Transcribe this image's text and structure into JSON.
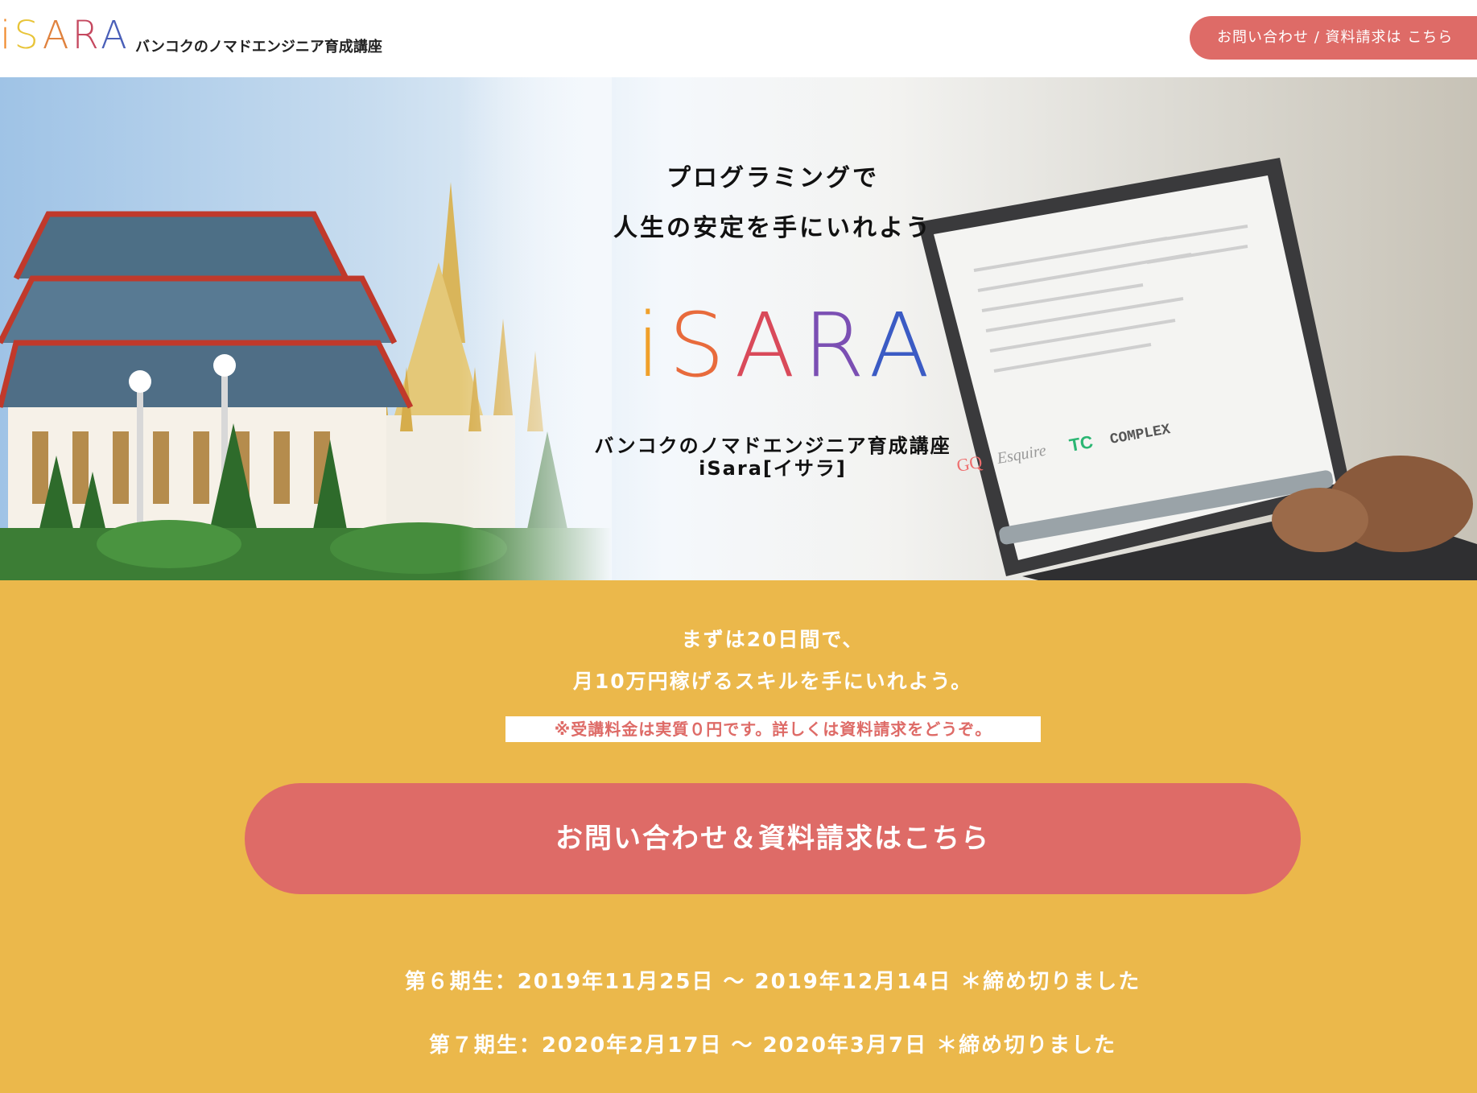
{
  "header": {
    "logo_letters": [
      "i",
      "S",
      "A",
      "R",
      "A"
    ],
    "tagline": "バンコクのノマドエンジニア育成講座",
    "cta": "お問い合わせ / 資料請求は こちら"
  },
  "hero": {
    "headline_1": "プログラミングで",
    "headline_2": "人生の安定を手にいれよう",
    "logo_letters": [
      "i",
      "S",
      "A",
      "R",
      "A"
    ],
    "subtitle_1": "バンコクのノマドエンジニア育成講座",
    "subtitle_2": "iSara[イサラ]",
    "laptop_logos": [
      "GQ",
      "Esquire",
      "TC",
      "COMPLEX"
    ]
  },
  "promo": {
    "line_1": "まずは20日間で、",
    "line_2": "月10万円稼げるスキルを手にいれよう。",
    "notice": "※受講料金は実質０円です。詳しくは資料請求をどうぞ。",
    "cta": "お問い合わせ＆資料請求はこちら",
    "terms": [
      "第６期生：2019年11月25日 ～ 2019年12月14日 ＊締め切りました",
      "第７期生：2020年2月17日 ～ 2020年3月7日 ＊締め切りました"
    ]
  },
  "colors": {
    "accent_coral": "#de6b67",
    "section_yellow": "#ebb84b",
    "logo_gradient": [
      "#e3342f",
      "#f6993f",
      "#ffed4a",
      "#38c172",
      "#3490dc",
      "#9561e2"
    ]
  }
}
